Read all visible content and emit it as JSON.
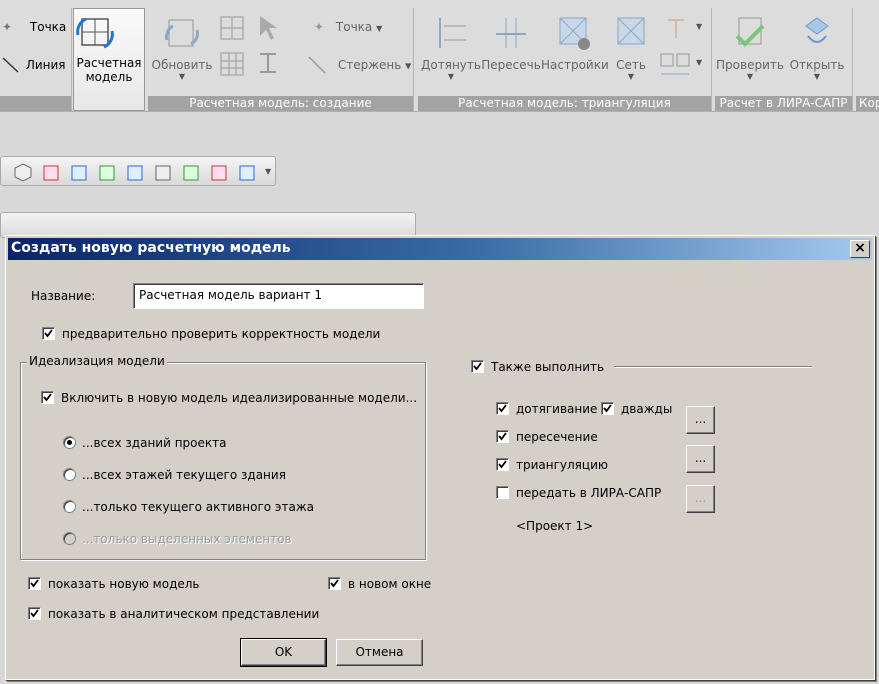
{
  "ribbon": {
    "point_small": "Точка",
    "line_small": "Линия",
    "calc_model": [
      "Расчетная",
      "модель"
    ],
    "update": "Обновить",
    "point2": "Точка",
    "rods": "Стержень",
    "group_create": "Расчетная модель: создание",
    "extend": "Дотянуть",
    "intersect": "Пересечь",
    "settings": "Настройки",
    "mesh": "Сеть",
    "group_triang": "Расчетная модель: триангуляция",
    "check": "Проверить",
    "open": "Открыть",
    "group_lira": "Расчет в ЛИРА-САПР",
    "group_cut": "Кор"
  },
  "dialog": {
    "title": "Создать новую расчетную модель",
    "close_label": "×",
    "name_label": "Название:",
    "name_value": "Расчетная модель вариант 1",
    "precheck_label": "предварительно проверить корректность модели",
    "ideal_group_title": "Идеализация модели",
    "include_ideal_label": "Включить в новую модель идеализированные модели...",
    "radio_all_buildings": "...всех зданий проекта",
    "radio_all_floors": "...всех этажей текущего здания",
    "radio_current_floor": "...только текущего активного этажа",
    "radio_selected": "...только выделенных элементов",
    "also_do_label": "Также выполнить",
    "extend_label": "дотягивание",
    "twice_label": "дважды",
    "intersect_label": "пересечение",
    "triang_label": "триангуляцию",
    "transfer_label": "передать в ЛИРА-САПР",
    "project_label": "<Проект 1>",
    "ellipsis": "...",
    "show_new_label": "показать новую модель",
    "new_window_label": "в новом окне",
    "show_analytic_label": "показать в аналитическом представлении",
    "ok_label": "OK",
    "cancel_label": "Отмена"
  }
}
